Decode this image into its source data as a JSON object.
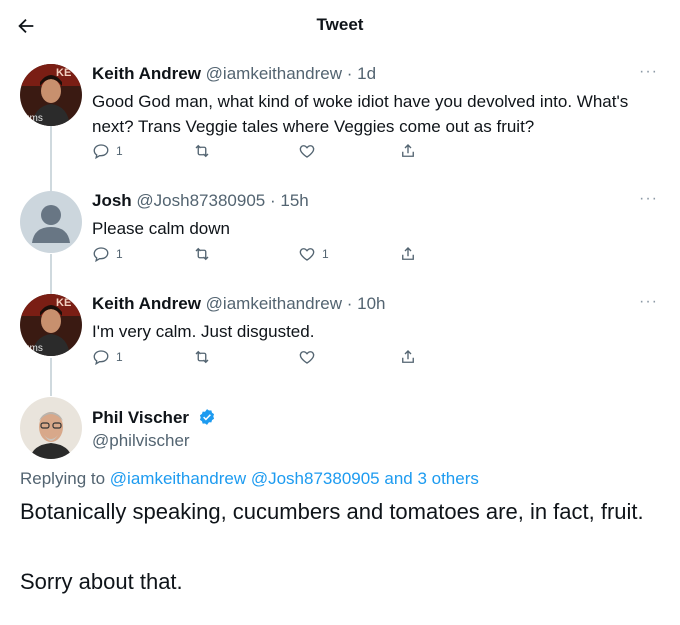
{
  "header": {
    "title": "Tweet"
  },
  "tweets": [
    {
      "name": "Keith Andrew",
      "handle": "@iamkeithandrew",
      "time": "1d",
      "text": "Good God man, what kind of woke idiot have you devolved into. What's next? Trans Veggie tales where Veggies come out as fruit?",
      "replies": "1",
      "retweets": "",
      "likes": ""
    },
    {
      "name": "Josh",
      "handle": "@Josh87380905",
      "time": "15h",
      "text": "Please calm down",
      "replies": "1",
      "retweets": "",
      "likes": "1"
    },
    {
      "name": "Keith Andrew",
      "handle": "@iamkeithandrew",
      "time": "10h",
      "text": "I'm very calm. Just disgusted.",
      "replies": "1",
      "retweets": "",
      "likes": ""
    }
  ],
  "main_tweet": {
    "name": "Phil Vischer",
    "handle": "@philvischer",
    "replying_prefix": "Replying to",
    "replying_to": "@iamkeithandrew @Josh87380905 and 3 others",
    "text_1": "Botanically speaking, cucumbers and tomatoes are, in fact, fruit.",
    "text_2": "Sorry about that."
  },
  "avatar_text": {
    "top": "KE",
    "bottom": "ums"
  },
  "dot": "·",
  "more_glyph": "···",
  "colors": {
    "accent": "#1d9bf0",
    "muted": "#536471",
    "line": "#cfd9de"
  },
  "icons": [
    "back-arrow-icon",
    "reply-icon",
    "retweet-icon",
    "like-icon",
    "share-icon",
    "more-icon",
    "verified-badge-icon"
  ]
}
